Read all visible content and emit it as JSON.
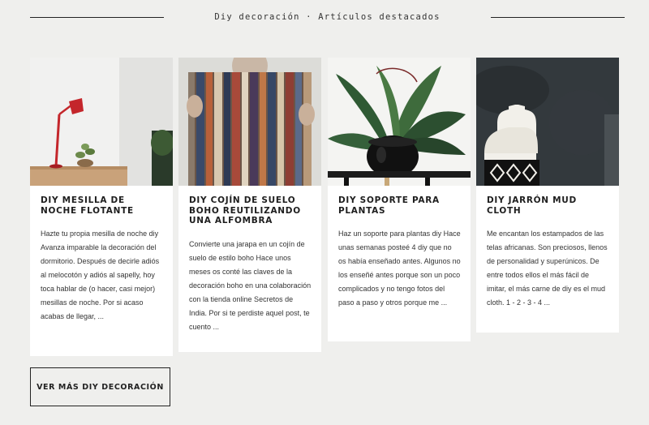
{
  "section": {
    "title": "Diy decoración · Artículos destacados"
  },
  "cards": [
    {
      "image_alt": "red-lamp-photo",
      "title": "DIY MESILLA DE NOCHE FLOTANTE",
      "excerpt": "Hazte tu propia mesilla de noche diy Avanza imparable la decoración del dormitorio. Después de decirle adiós al melocotón y adiós al sapelly, hoy toca hablar de (o hacer, casi mejor) mesillas de noche. Por si acaso acabas de llegar, ..."
    },
    {
      "image_alt": "striped-rug-photo",
      "title": "DIY COJÍN DE SUELO BOHO REUTILIZANDO UNA ALFOMBRA",
      "excerpt": "Convierte una jarapa en un cojín de suelo de estilo boho Hace unos meses os conté las claves de la decoración boho en una colaboración con la tienda online Secretos de India. Por si te perdiste aquel post, te cuento ..."
    },
    {
      "image_alt": "plant-stand-photo",
      "title": "DIY SOPORTE PARA PLANTAS",
      "excerpt": "Haz un soporte para plantas diy Hace unas semanas posteé 4 diy que no os había enseñado antes. Algunos no los enseñé antes porque son un poco complicados y no tengo fotos del paso a paso y otros porque me ..."
    },
    {
      "image_alt": "mud-cloth-vase-photo",
      "title": "DIY JARRÓN MUD CLOTH",
      "excerpt": "Me encantan los estampados de las telas africanas. Son preciosos, llenos de personalidad y superúnicos. De entre todos ellos el más fácil de imitar, el más carne de diy es el mud cloth. 1 - 2 - 3 - 4 ..."
    }
  ],
  "more_button": {
    "label": "VER MÁS DIY DECORACIÓN"
  }
}
